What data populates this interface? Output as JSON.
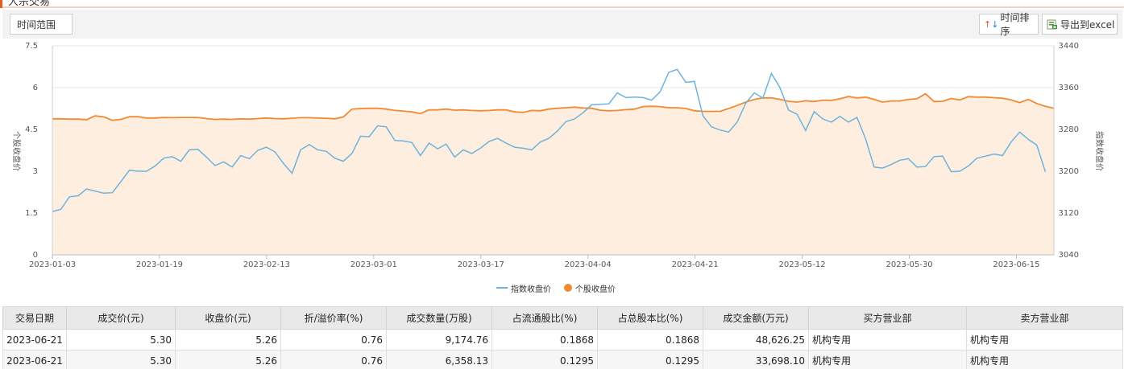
{
  "header": {
    "title": "大宗交易"
  },
  "toolbar": {
    "range_label": "时间范围",
    "sort_label": "时间排序",
    "export_label": "导出到excel"
  },
  "colors": {
    "index_line": "#6eb3dc",
    "stock_line": "#f28a31",
    "stock_fill": "#fdeee0",
    "accent": "#e85d1d"
  },
  "chart_data": {
    "type": "line",
    "left_axis": {
      "title": "个股收盘价",
      "ticks": [
        "7.5",
        "6",
        "4.5",
        "3",
        "1.5",
        "0"
      ],
      "ylim": [
        0,
        7.5
      ]
    },
    "right_axis": {
      "title": "指数收盘价",
      "ticks": [
        "3440",
        "3360",
        "3280",
        "3200",
        "3120",
        "3040"
      ],
      "ylim": [
        3040,
        3440
      ]
    },
    "x_ticks": [
      "2023-01-03",
      "2023-01-19",
      "2023-02-13",
      "2023-03-01",
      "2023-03-17",
      "2023-04-04",
      "2023-04-21",
      "2023-05-12",
      "2023-05-30",
      "2023-06-15"
    ],
    "grid": true,
    "legend_position": "bottom-center",
    "series": [
      {
        "name": "指数收盘价",
        "axis": "right",
        "values": [
          3123,
          3127,
          3151,
          3153,
          3166,
          3162,
          3158,
          3159,
          3180,
          3202,
          3200,
          3200,
          3210,
          3225,
          3228,
          3219,
          3241,
          3242,
          3227,
          3211,
          3218,
          3208,
          3230,
          3224,
          3240,
          3246,
          3237,
          3215,
          3196,
          3241,
          3251,
          3241,
          3238,
          3225,
          3219,
          3234,
          3267,
          3266,
          3287,
          3285,
          3259,
          3258,
          3255,
          3230,
          3254,
          3243,
          3252,
          3227,
          3241,
          3234,
          3244,
          3257,
          3263,
          3254,
          3246,
          3244,
          3241,
          3256,
          3263,
          3277,
          3295,
          3300,
          3312,
          3327,
          3328,
          3329,
          3350,
          3341,
          3342,
          3341,
          3336,
          3352,
          3389,
          3395,
          3370,
          3372,
          3306,
          3285,
          3279,
          3275,
          3294,
          3330,
          3350,
          3340,
          3387,
          3360,
          3317,
          3309,
          3278,
          3314,
          3300,
          3294,
          3305,
          3294,
          3303,
          3262,
          3208,
          3206,
          3213,
          3221,
          3224,
          3208,
          3209,
          3228,
          3229,
          3199,
          3200,
          3210,
          3225,
          3229,
          3233,
          3230,
          3256,
          3275,
          3261,
          3250,
          3199
        ]
      },
      {
        "name": "个股收盘价",
        "axis": "left",
        "values": [
          4.88,
          4.88,
          4.87,
          4.87,
          4.85,
          4.99,
          4.95,
          4.83,
          4.86,
          4.96,
          4.96,
          4.91,
          4.91,
          4.93,
          4.92,
          4.93,
          4.93,
          4.93,
          4.89,
          4.86,
          4.87,
          4.86,
          4.88,
          4.87,
          4.89,
          4.91,
          4.89,
          4.88,
          4.9,
          4.92,
          4.92,
          4.91,
          4.9,
          4.88,
          4.95,
          5.23,
          5.25,
          5.26,
          5.26,
          5.23,
          5.18,
          5.16,
          5.13,
          5.07,
          5.2,
          5.2,
          5.23,
          5.19,
          5.2,
          5.18,
          5.17,
          5.18,
          5.2,
          5.2,
          5.13,
          5.11,
          5.18,
          5.17,
          5.23,
          5.26,
          5.28,
          5.3,
          5.27,
          5.26,
          5.19,
          5.17,
          5.18,
          5.21,
          5.23,
          5.32,
          5.33,
          5.32,
          5.28,
          5.28,
          5.25,
          5.17,
          5.15,
          5.15,
          5.15,
          5.25,
          5.36,
          5.48,
          5.58,
          5.63,
          5.63,
          5.58,
          5.51,
          5.48,
          5.53,
          5.5,
          5.55,
          5.54,
          5.6,
          5.68,
          5.63,
          5.66,
          5.58,
          5.48,
          5.52,
          5.52,
          5.58,
          5.6,
          5.78,
          5.5,
          5.51,
          5.61,
          5.56,
          5.68,
          5.66,
          5.66,
          5.64,
          5.62,
          5.56,
          5.46,
          5.58,
          5.43,
          5.33,
          5.26
        ]
      }
    ]
  },
  "table": {
    "headers": [
      "交易日期",
      "成交价(元)",
      "收盘价(元)",
      "折/溢价率(%)",
      "成交数量(万股)",
      "占流通股比(%)",
      "占总股本比(%)",
      "成交金额(万元)",
      "买方营业部",
      "卖方营业部"
    ],
    "rows": [
      [
        "2023-06-21",
        "5.30",
        "5.26",
        "0.76",
        "9,174.76",
        "0.1868",
        "0.1868",
        "48,626.25",
        "机构专用",
        "机构专用"
      ],
      [
        "2023-06-21",
        "5.30",
        "5.26",
        "0.76",
        "6,358.13",
        "0.1295",
        "0.1295",
        "33,698.10",
        "机构专用",
        "机构专用"
      ]
    ]
  }
}
